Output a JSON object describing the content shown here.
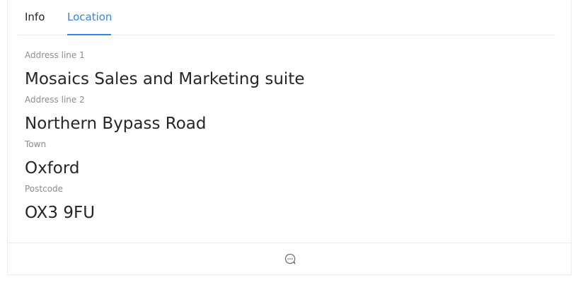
{
  "tabs": [
    {
      "label": "Info",
      "active": false
    },
    {
      "label": "Location",
      "active": true
    }
  ],
  "fields": [
    {
      "label": "Address line 1",
      "value": "Mosaics Sales and Marketing suite"
    },
    {
      "label": "Address line 2",
      "value": "Northern Bypass Road"
    },
    {
      "label": "Town",
      "value": "Oxford"
    },
    {
      "label": "Postcode",
      "value": "OX3 9FU"
    }
  ],
  "footer": {
    "icon": "chat-bubble-icon"
  },
  "colors": {
    "accent": "#2f88e6",
    "text": "#262626",
    "muted": "#8c8c8c",
    "border": "#ececec"
  }
}
